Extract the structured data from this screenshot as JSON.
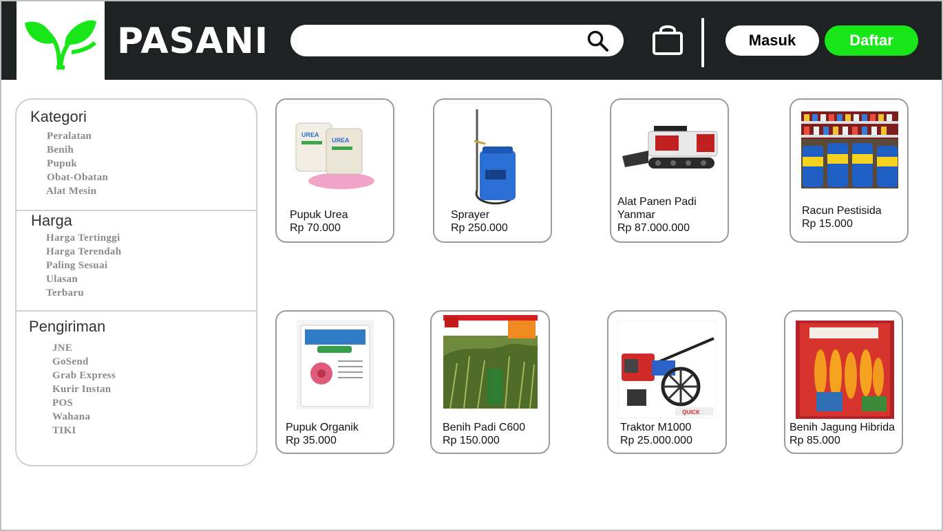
{
  "brand": {
    "name": "PASANI",
    "logo_icon": "leaf-logo-icon",
    "accent": "#19e619",
    "header_bg": "#1f2222"
  },
  "search": {
    "placeholder": "",
    "value": ""
  },
  "header": {
    "login_label": "Masuk",
    "register_label": "Daftar"
  },
  "sidebar": {
    "sections": [
      {
        "title": "Kategori",
        "items": [
          "Peralatan",
          "Benih",
          "Pupuk",
          "Obat-Obatan",
          "Alat Mesin"
        ]
      },
      {
        "title": "Harga",
        "items": [
          "Harga Tertinggi",
          "Harga Terendah",
          "Paling Sesuai",
          "Ulasan",
          "Terbaru"
        ]
      },
      {
        "title": "Pengiriman",
        "items": [
          "JNE",
          "GoSend",
          "Grab Express",
          "Kurir Instan",
          "POS",
          "Wahana",
          "TIKI"
        ]
      }
    ]
  },
  "products": [
    {
      "name": "Pupuk Urea",
      "price": "Rp 70.000"
    },
    {
      "name": "Sprayer",
      "price": "Rp 250.000"
    },
    {
      "name": "Alat Panen Padi Yanmar",
      "price": "Rp 87.000.000"
    },
    {
      "name": "Racun Pestisida",
      "price": "Rp 15.000"
    },
    {
      "name": "Pupuk Organik",
      "price": "Rp 35.000"
    },
    {
      "name": "Benih Padi C600",
      "price": "Rp 150.000"
    },
    {
      "name": "Traktor M1000",
      "price": "Rp 25.000.000"
    },
    {
      "name": "Benih Jagung Hibrida",
      "price": "Rp 85.000"
    }
  ]
}
